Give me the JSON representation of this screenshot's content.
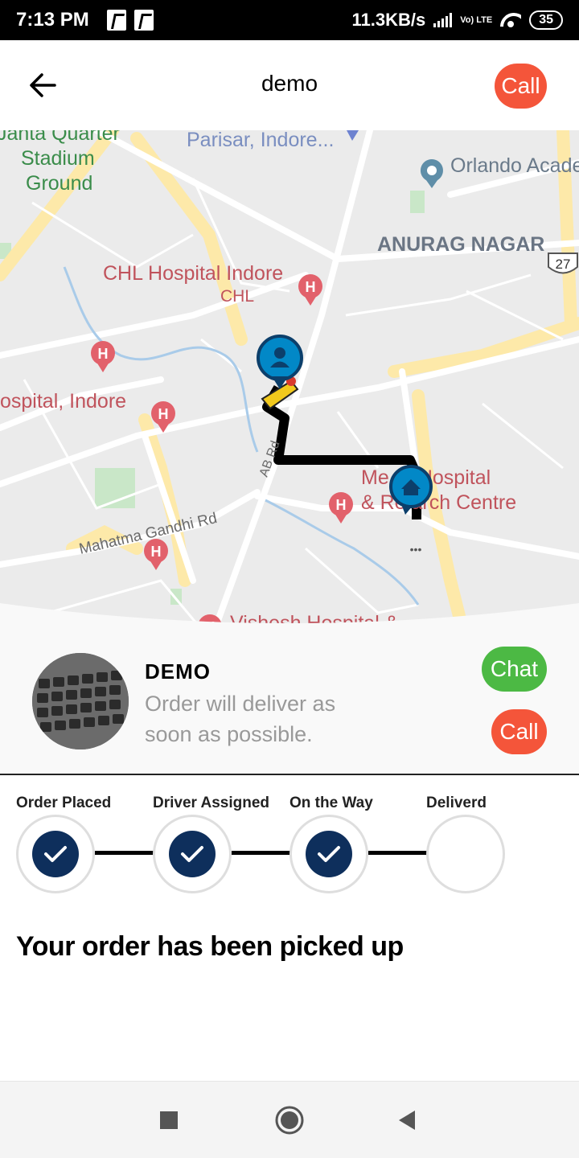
{
  "status_bar": {
    "time": "7:13 PM",
    "network_speed": "11.3KB/s",
    "volte": "Vo) LTE",
    "battery": "35"
  },
  "header": {
    "title": "demo",
    "back_icon": "arrow-left-icon",
    "call_label": "Call"
  },
  "map": {
    "labels": [
      "Janta Quarter Stadium Ground",
      "Parisar, Indore...",
      "Orlando Acade",
      "ANURAG NAGAR",
      "27",
      "CHL Hospital Indore",
      "CHL",
      "ospital, Indore",
      "Mahatma Gandhi Rd",
      "AB Rd",
      "Me   re Hospital",
      "& Re   arch Centre",
      "Vishesh Hospital &"
    ],
    "colors": {
      "route": "#000000",
      "marker": "#0288c7",
      "hospital_pin": "#e2616b",
      "road": "#ffffff",
      "major_road": "#fde9a9",
      "background": "#ebebeb"
    }
  },
  "driver": {
    "name": "DEMO",
    "message": "Order will deliver as soon as possible.",
    "chat_label": "Chat",
    "call_label": "Call"
  },
  "steps": [
    {
      "label": "Order Placed",
      "done": true
    },
    {
      "label": "Driver Assigned",
      "done": true
    },
    {
      "label": "On the Way",
      "done": true
    },
    {
      "label": "Deliverd",
      "done": false
    }
  ],
  "order_status": "Your order has been picked up",
  "colors": {
    "call": "#f4553a",
    "chat": "#4cb944",
    "step_done": "#0e2f5c"
  }
}
